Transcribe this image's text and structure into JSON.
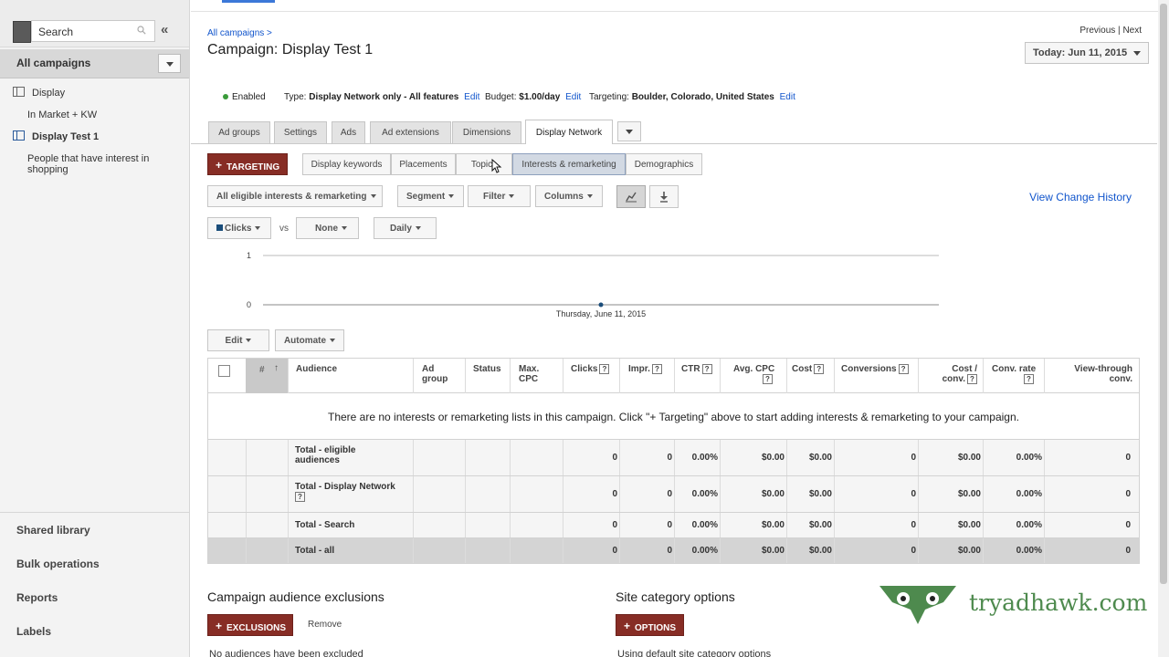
{
  "sidebar": {
    "search_label": "Search",
    "collapse_label": "«",
    "all_campaigns": "All campaigns",
    "tree": [
      {
        "label": "Display"
      },
      {
        "label": "In Market + KW"
      },
      {
        "label": "Display Test 1"
      },
      {
        "label": "People that have interest in shopping"
      }
    ],
    "bottom": [
      "Shared library",
      "Bulk operations",
      "Reports",
      "Labels"
    ]
  },
  "header": {
    "breadcrumb": "All campaigns >",
    "title": "Campaign: Display Test 1",
    "previous": "Previous",
    "separator": "|",
    "next": "Next",
    "date": "Today: Jun 11, 2015"
  },
  "status": {
    "enabled": "Enabled",
    "type_label": "Type:",
    "type_value": "Display Network only - All features",
    "budget_label": "Budget:",
    "budget_value": "$1.00/day",
    "targeting_label": "Targeting:",
    "targeting_value": "Boulder, Colorado, United States",
    "edit": "Edit"
  },
  "tabs": [
    {
      "label": "Ad groups"
    },
    {
      "label": "Settings"
    },
    {
      "label": "Ads"
    },
    {
      "label": "Ad extensions"
    },
    {
      "label": "Dimensions"
    },
    {
      "label": "Display Network"
    }
  ],
  "targeting": {
    "button": "TARGETING",
    "segments": [
      "Display keywords",
      "Placements",
      "Topics",
      "Interests & remarketing",
      "Demographics"
    ]
  },
  "filters": {
    "scope": "All eligible interests & remarketing",
    "segment": "Segment",
    "filter": "Filter",
    "columns": "Columns",
    "view_change_history": "View Change History"
  },
  "chart_controls": {
    "metric1": "Clicks",
    "vs": "vs",
    "metric2": "None",
    "granularity": "Daily",
    "metric_color": "#1a4d7a"
  },
  "chart_data": {
    "type": "line",
    "x": [
      "Thursday, June 11, 2015"
    ],
    "series": [
      {
        "name": "Clicks",
        "values": [
          0
        ]
      }
    ],
    "yticks": [
      0,
      1
    ],
    "ylim": [
      0,
      1
    ],
    "xlabel": "Thursday, June 11, 2015"
  },
  "actions": {
    "edit": "Edit",
    "automate": "Automate"
  },
  "table": {
    "headers": {
      "sort": "#",
      "audience": "Audience",
      "ad_group_1": "Ad",
      "ad_group_2": "group",
      "status": "Status",
      "max_cpc_1": "Max.",
      "max_cpc_2": "CPC",
      "clicks": "Clicks",
      "impr": "Impr.",
      "ctr": "CTR",
      "avg_cpc": "Avg. CPC",
      "cost": "Cost",
      "conversions": "Conversions",
      "cost_conv_1": "Cost /",
      "cost_conv_2": "conv.",
      "conv_rate_1": "Conv. rate",
      "view_through_1": "View-through",
      "view_through_2": "conv.",
      "help": "?"
    },
    "empty_message": "There are no interests or remarketing lists in this campaign. Click \"+ Targeting\" above to start adding interests & remarketing to your campaign.",
    "rows": [
      {
        "label_1": "Total - eligible",
        "label_2": "audiences",
        "clicks": "0",
        "impr": "0",
        "ctr": "0.00%",
        "avg_cpc": "$0.00",
        "cost": "$0.00",
        "conversions": "0",
        "cost_conv": "$0.00",
        "conv_rate": "0.00%",
        "view_through": "0"
      },
      {
        "label_1": "Total - Display Network",
        "label_2": "",
        "clicks": "0",
        "impr": "0",
        "ctr": "0.00%",
        "avg_cpc": "$0.00",
        "cost": "$0.00",
        "conversions": "0",
        "cost_conv": "$0.00",
        "conv_rate": "0.00%",
        "view_through": "0"
      },
      {
        "label_1": "Total - Search",
        "label_2": "",
        "clicks": "0",
        "impr": "0",
        "ctr": "0.00%",
        "avg_cpc": "$0.00",
        "cost": "$0.00",
        "conversions": "0",
        "cost_conv": "$0.00",
        "conv_rate": "0.00%",
        "view_through": "0"
      },
      {
        "label_1": "Total - all",
        "label_2": "",
        "clicks": "0",
        "impr": "0",
        "ctr": "0.00%",
        "avg_cpc": "$0.00",
        "cost": "$0.00",
        "conversions": "0",
        "cost_conv": "$0.00",
        "conv_rate": "0.00%",
        "view_through": "0"
      }
    ]
  },
  "exclusions": {
    "title": "Campaign audience exclusions",
    "button": "EXCLUSIONS",
    "remove": "Remove",
    "note": "No audiences have been excluded"
  },
  "site_category": {
    "title": "Site category options",
    "button": "OPTIONS",
    "note": "Using default site category options"
  },
  "watermark": {
    "text": "tryadhawk.com",
    "color": "#4e8a4e"
  },
  "colors": {
    "accent_red": "#872d25",
    "link_blue": "#1155cc",
    "enabled_green": "#3a9b3a"
  }
}
